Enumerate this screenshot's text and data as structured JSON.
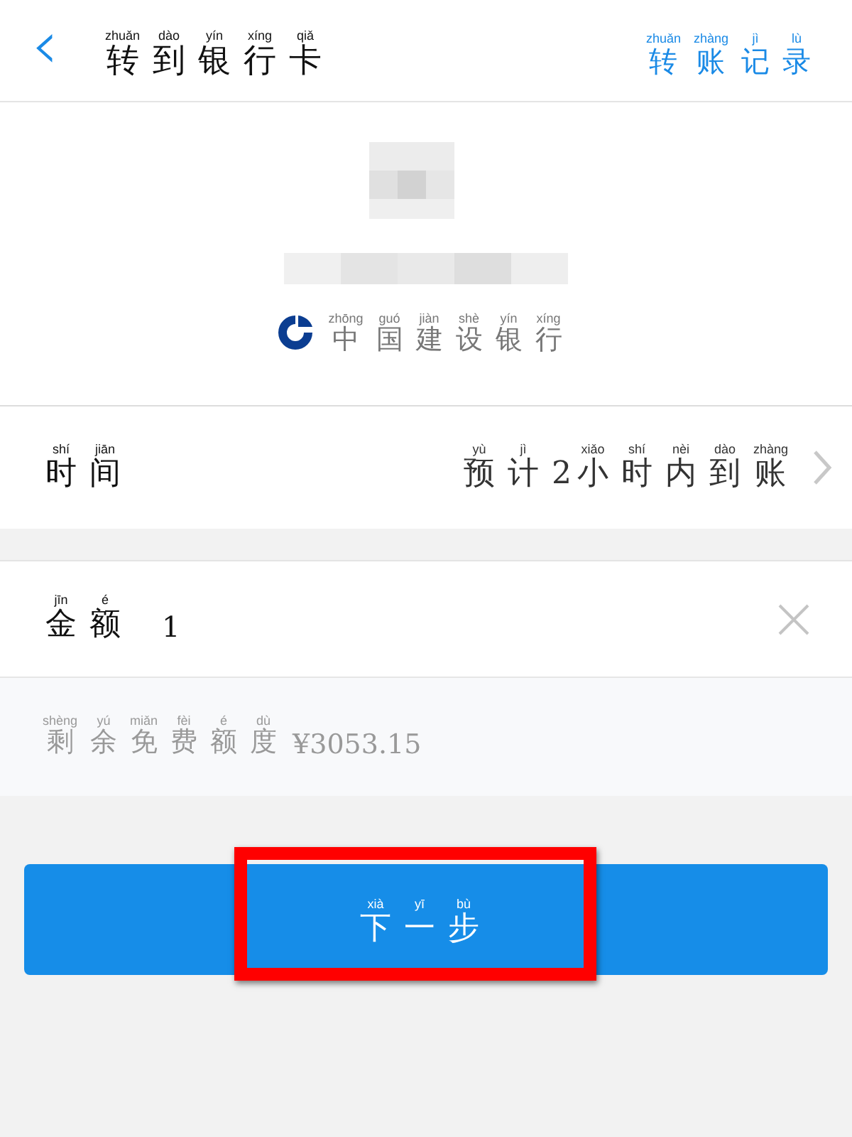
{
  "header": {
    "back_icon": "‹",
    "title": [
      [
        "zhuǎn",
        "转"
      ],
      [
        "dào",
        "到"
      ],
      [
        "yín",
        "银"
      ],
      [
        "xíng",
        "行"
      ],
      [
        "qiǎ",
        "卡"
      ]
    ],
    "records_link": [
      [
        "zhuǎn",
        "转"
      ],
      [
        "zhàng",
        "账"
      ],
      [
        "jì",
        "记"
      ],
      [
        "lù",
        "录"
      ]
    ]
  },
  "bank": {
    "name": [
      [
        "zhōng",
        "中"
      ],
      [
        "guó",
        "国"
      ],
      [
        "jiàn",
        "建"
      ],
      [
        "shè",
        "设"
      ],
      [
        "yín",
        "银"
      ],
      [
        "xíng",
        "行"
      ]
    ]
  },
  "time_row": {
    "label": [
      [
        "shí",
        "时"
      ],
      [
        "jiān",
        "间"
      ]
    ],
    "value": [
      [
        "yù",
        "预"
      ],
      [
        "jì",
        "计"
      ],
      [
        "2"
      ],
      [
        "xiǎo",
        "小"
      ],
      [
        "shí",
        "时"
      ],
      [
        "nèi",
        "内"
      ],
      [
        "dào",
        "到"
      ],
      [
        "zhàng",
        "账"
      ]
    ]
  },
  "amount_row": {
    "label": [
      [
        "jīn",
        "金"
      ],
      [
        "é",
        "额"
      ]
    ],
    "value": "1"
  },
  "quota": {
    "label": [
      [
        "shèng",
        "剩"
      ],
      [
        "yú",
        "余"
      ],
      [
        "miǎn",
        "免"
      ],
      [
        "fèi",
        "费"
      ],
      [
        "é",
        "额"
      ],
      [
        "dù",
        "度"
      ]
    ],
    "amount": "¥3053.15"
  },
  "next_button": {
    "label": [
      [
        "xià",
        "下"
      ],
      [
        "yī",
        "一"
      ],
      [
        "bù",
        "步"
      ]
    ],
    "highlighted": true
  }
}
